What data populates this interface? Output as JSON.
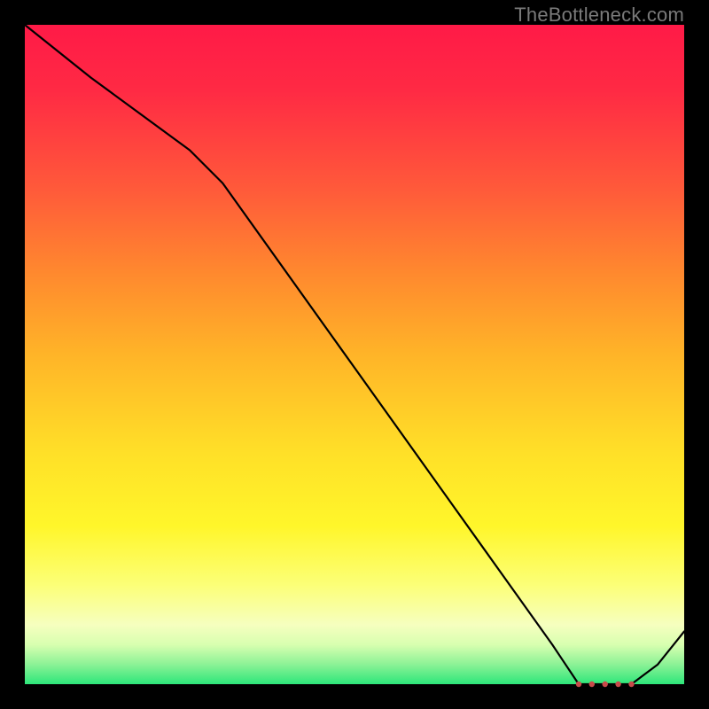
{
  "watermark": "TheBottleneck.com",
  "chart_data": {
    "type": "line",
    "title": "",
    "xlabel": "",
    "ylabel": "",
    "xlim": [
      0,
      100
    ],
    "ylim": [
      0,
      100
    ],
    "x": [
      0,
      10,
      25,
      30,
      50,
      70,
      80,
      84,
      86,
      88,
      90,
      92,
      96,
      100
    ],
    "y": [
      100,
      92,
      81,
      76,
      48,
      20,
      6,
      0,
      0,
      0,
      0,
      0,
      3,
      8
    ],
    "marker_x": [
      84,
      86,
      88,
      90,
      92
    ],
    "marker_y": [
      0,
      0,
      0,
      0,
      0
    ],
    "gradient_stops": [
      {
        "pos": 0.0,
        "color": "#ff1a47"
      },
      {
        "pos": 0.5,
        "color": "#ffb428"
      },
      {
        "pos": 0.8,
        "color": "#fff62a"
      },
      {
        "pos": 0.95,
        "color": "#d8ffb0"
      },
      {
        "pos": 1.0,
        "color": "#2de67a"
      }
    ]
  }
}
